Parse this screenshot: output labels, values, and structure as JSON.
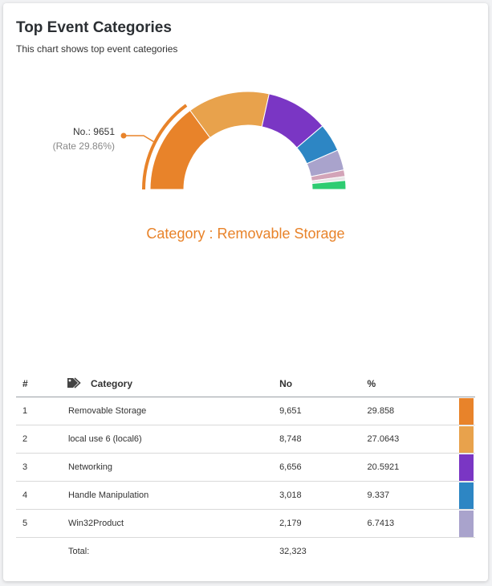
{
  "header": {
    "title": "Top Event Categories",
    "subtitle": "This chart shows top event categories"
  },
  "tooltip": {
    "count_label": "No.: 9651",
    "rate_label": "(Rate 29.86%)"
  },
  "selected_category_label": "Category : Removable Storage",
  "table": {
    "columns": [
      "#",
      "Category",
      "No",
      "%"
    ],
    "rows": [
      {
        "index": "1",
        "category": "Removable Storage",
        "no": "9,651",
        "pct": "29.858",
        "color": "#e8832a"
      },
      {
        "index": "2",
        "category": "local use 6 (local6)",
        "no": "8,748",
        "pct": "27.0643",
        "color": "#e8a24c"
      },
      {
        "index": "3",
        "category": "Networking",
        "no": "6,656",
        "pct": "20.5921",
        "color": "#7a36c4"
      },
      {
        "index": "4",
        "category": "Handle Manipulation",
        "no": "3,018",
        "pct": "9.337",
        "color": "#2d86c4"
      },
      {
        "index": "5",
        "category": "Win32Product",
        "no": "2,179",
        "pct": "6.7413",
        "color": "#a9a3cc"
      }
    ],
    "total_label": "Total:",
    "total_value": "32,323"
  },
  "chart_data": {
    "type": "pie",
    "subtype": "semi-donut",
    "selected": "Removable Storage",
    "slices": [
      {
        "label": "Removable Storage",
        "value": 9651,
        "color": "#e8832a"
      },
      {
        "label": "local use 6 (local6)",
        "value": 8748,
        "color": "#e8a24c"
      },
      {
        "label": "Networking",
        "value": 6656,
        "color": "#7a36c4"
      },
      {
        "label": "Handle Manipulation",
        "value": 3018,
        "color": "#2d86c4"
      },
      {
        "label": "Win32Product",
        "value": 2179,
        "color": "#a9a3cc"
      },
      {
        "value": 700,
        "color": "#d3a4b8"
      },
      {
        "value": 420,
        "color": "#e8e8e8"
      },
      {
        "value": 951,
        "color": "#2ecc71"
      }
    ]
  }
}
